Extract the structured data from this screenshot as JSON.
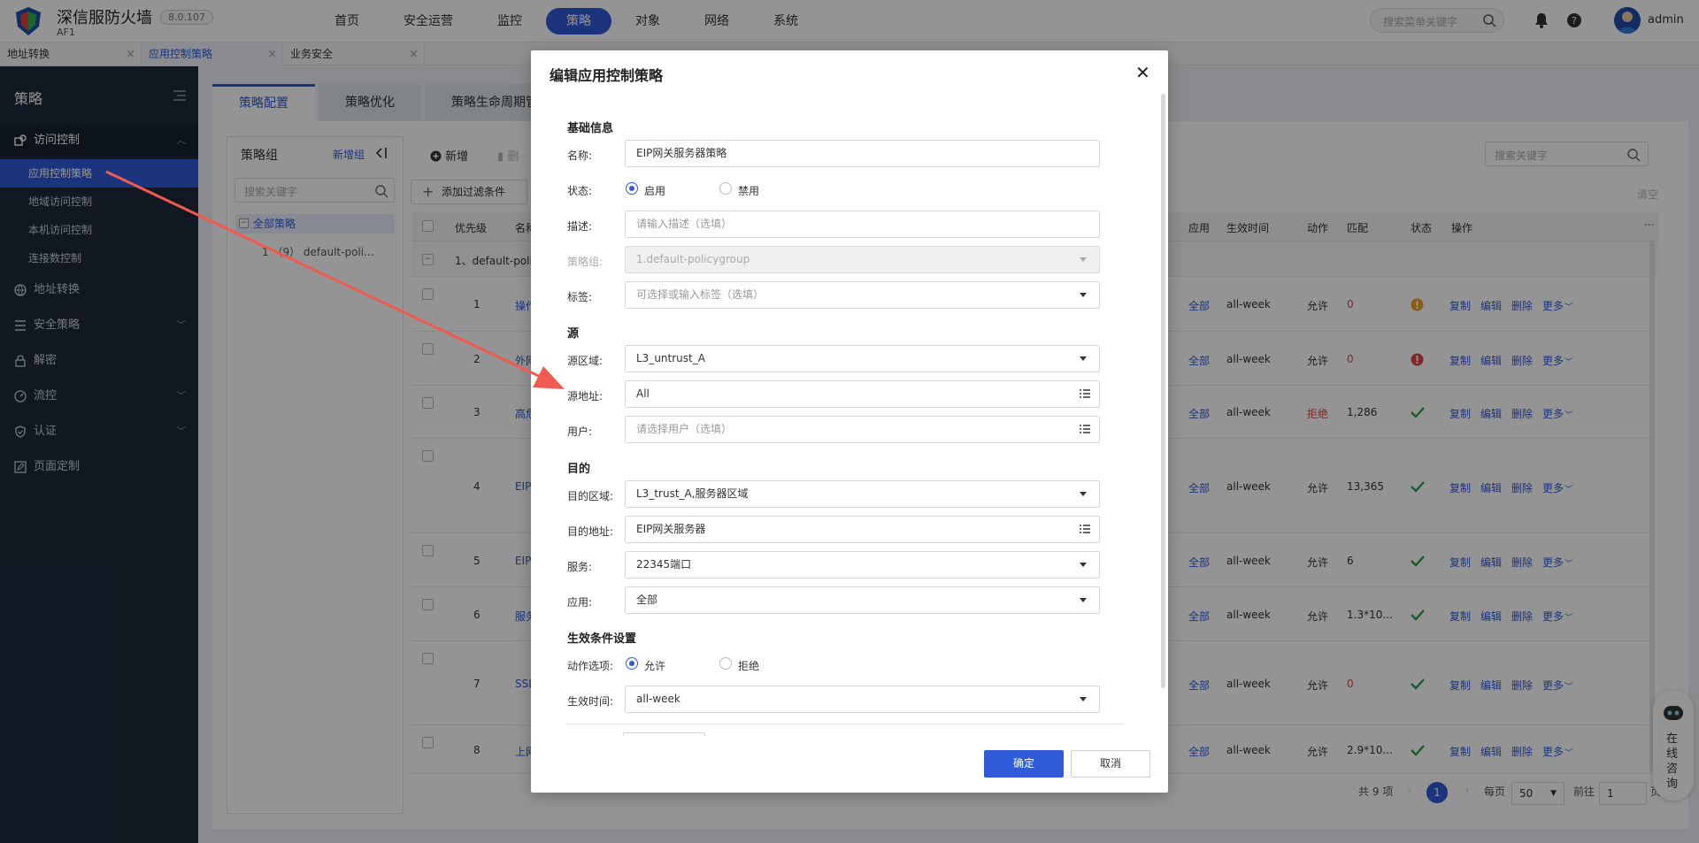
{
  "app": {
    "brand": "深信服防火墙",
    "product": "AF1",
    "version": "8.0.107",
    "user": "admin"
  },
  "topnav": [
    "首页",
    "安全运营",
    "监控",
    "策略",
    "对象",
    "网络",
    "系统"
  ],
  "topnav_active": "策略",
  "top_search_placeholder": "搜索菜单关键字",
  "page_tabs": [
    {
      "label": "地址转换"
    },
    {
      "label": "应用控制策略",
      "active": true
    },
    {
      "label": "业务安全"
    }
  ],
  "sidebar": {
    "title": "策略",
    "groups": [
      {
        "label": "访问控制",
        "open": true
      },
      {
        "label": "地址转换"
      },
      {
        "label": "安全策略"
      },
      {
        "label": "解密"
      },
      {
        "label": "流控"
      },
      {
        "label": "认证"
      },
      {
        "label": "页面定制"
      }
    ],
    "access_items": [
      "应用控制策略",
      "地域访问控制",
      "本机访问控制",
      "连接数控制"
    ]
  },
  "sub_tabs": [
    "策略配置",
    "策略优化",
    "策略生命周期管"
  ],
  "left_panel": {
    "title": "策略组",
    "add": "新增组",
    "search_placeholder": "搜索关键字",
    "tree_root": "全部策略",
    "tree_child": "1 （9） default-poli..."
  },
  "toolbar": {
    "new": "新增",
    "delete": "删",
    "filter": "添加过滤条件",
    "search_placeholder": "搜索关键字",
    "clear": "清空"
  },
  "table": {
    "headers": {
      "priority": "优先级",
      "name": "名称",
      "app": "应用",
      "time": "生效时间",
      "action": "动作",
      "match": "匹配",
      "status": "状态",
      "ops": "操作"
    },
    "group_row": "1、default-poli",
    "rows": [
      {
        "priority": "1",
        "name": "操作",
        "app": "全部",
        "time": "all-week",
        "action": "允许",
        "match": "0",
        "status": "warn"
      },
      {
        "priority": "2",
        "name": "外网",
        "app": "全部",
        "time": "all-week",
        "action": "允许",
        "match": "0",
        "status": "error"
      },
      {
        "priority": "3",
        "name": "高危",
        "app": "全部",
        "time": "all-week",
        "action": "拒绝",
        "match": "1,286",
        "status": "ok"
      },
      {
        "priority": "4",
        "name": "EIP",
        "app": "全部",
        "time": "all-week",
        "action": "允许",
        "match": "13,365",
        "status": "ok"
      },
      {
        "priority": "5",
        "name": "EIP",
        "app": "全部",
        "time": "all-week",
        "action": "允许",
        "match": "6",
        "status": "ok"
      },
      {
        "priority": "6",
        "name": "服务",
        "app": "全部",
        "time": "all-week",
        "action": "允许",
        "match": "1.3*10...",
        "status": "ok"
      },
      {
        "priority": "7",
        "name": "SSL",
        "app": "全部",
        "time": "all-week",
        "action": "允许",
        "match": "0",
        "status": "ok"
      },
      {
        "priority": "8",
        "name": "上网",
        "app": "全部",
        "time": "all-week",
        "action": "允许",
        "match": "2.9*10...",
        "status": "ok"
      }
    ],
    "ops": [
      "复制",
      "编辑",
      "删除",
      "更多"
    ],
    "ellipsis": "..."
  },
  "pagination": {
    "total": "共 9 项",
    "page": "1",
    "per_page_label": "每页",
    "per_page": "50",
    "goto_label": "前往",
    "goto": "1",
    "goto_suffix": "页"
  },
  "dialog": {
    "title": "编辑应用控制策略",
    "sections": {
      "basic": "基础信息",
      "source": "源",
      "dest": "目的",
      "effect": "生效条件设置"
    },
    "fields": {
      "name": {
        "label": "名称:",
        "value": "EIP网关服务器策略"
      },
      "status": {
        "label": "状态:",
        "options": [
          "启用",
          "禁用"
        ],
        "selected": "启用"
      },
      "desc": {
        "label": "描述:",
        "placeholder": "请输入描述（选填）"
      },
      "group": {
        "label": "策略组:",
        "value": "1.default-policygroup"
      },
      "tag": {
        "label": "标签:",
        "placeholder": "可选择或输入标签（选填）"
      },
      "src_zone": {
        "label": "源区域:",
        "value": "L3_untrust_A"
      },
      "src_addr": {
        "label": "源地址:",
        "value": "All"
      },
      "user": {
        "label": "用户:",
        "placeholder": "请选择用户（选填）"
      },
      "dst_zone": {
        "label": "目的区域:",
        "value": "L3_trust_A,服务器区域"
      },
      "dst_addr": {
        "label": "目的地址:",
        "value": "EIP网关服务器"
      },
      "service": {
        "label": "服务:",
        "value": "22345端口"
      },
      "app": {
        "label": "应用:",
        "value": "全部"
      },
      "action": {
        "label": "动作选项:",
        "options": [
          "允许",
          "拒绝"
        ],
        "selected": "允许"
      },
      "time": {
        "label": "生效时间:",
        "value": "all-week"
      }
    },
    "ok": "确定",
    "cancel": "取消"
  },
  "online_help": "在线咨询",
  "colors": {
    "primary": "#2f5bd8",
    "sidebar": "#1e2a3c",
    "ok": "#2aa046",
    "warn": "#f0a020",
    "error": "#e04444",
    "arrow": "#f05a50"
  }
}
